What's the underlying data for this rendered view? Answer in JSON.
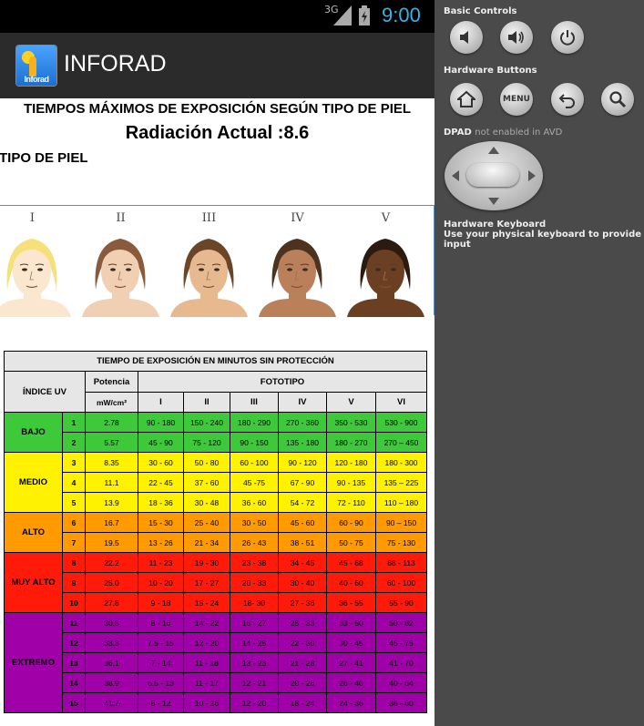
{
  "status_bar": {
    "network": "3G",
    "time": "9:00"
  },
  "app": {
    "title": "INFORAD",
    "logo_text": "Inforad"
  },
  "content": {
    "heading": "TIEMPOS MÁXIMOS DE EXPOSICIÓN SEGÚN TIPO DE PIEL",
    "radiation": "Radiación Actual :8.6",
    "skin_type_label": "TIPO DE PIEL",
    "skin_types": [
      "I",
      "II",
      "III",
      "IV",
      "V"
    ]
  },
  "table": {
    "title": "TIEMPO DE EXPOSICIÓN EN MINUTOS SIN PROTECCIÓN",
    "col_index": "ÍNDICE UV",
    "col_power": "Potencia",
    "col_power_unit": "mW/cm²",
    "col_phototype": "FOTOTIPO",
    "phototypes": [
      "I",
      "II",
      "III",
      "IV",
      "V",
      "VI"
    ],
    "groups": [
      {
        "name": "BAJO",
        "color": "#3ec93a",
        "rows": [
          [
            "1",
            "2.78",
            "90 - 180",
            "150 - 240",
            "180 - 290",
            "270 - 360",
            "350 - 530",
            "530 - 900"
          ],
          [
            "2",
            "5.57",
            "45 - 90",
            "75 - 120",
            "90 - 150",
            "135 - 180",
            "180 - 270",
            "270 – 450"
          ]
        ]
      },
      {
        "name": "MEDIO",
        "color": "#fff200",
        "rows": [
          [
            "3",
            "8.35",
            "30 - 60",
            "50 - 80",
            "60 - 100",
            "90 - 120",
            "120 - 180",
            "180 - 300"
          ],
          [
            "4",
            "11.1",
            "22 - 45",
            "37 - 60",
            "45 -75",
            "67 - 90",
            "90 - 135",
            "135 – 225"
          ],
          [
            "5",
            "13.9",
            "18 - 36",
            "30 - 48",
            "36 - 60",
            "54 - 72",
            "72 - 110",
            "110 – 180"
          ]
        ]
      },
      {
        "name": "ALTO",
        "color": "#ff9a00",
        "rows": [
          [
            "6",
            "16.7",
            "15 - 30",
            "25 - 40",
            "30 - 50",
            "45 - 60",
            "60 - 90",
            "90 – 150"
          ],
          [
            "7",
            "19.5",
            "13 - 26",
            "21 - 34",
            "26 - 43",
            "38 - 51",
            "50 - 75",
            "75 - 130"
          ]
        ]
      },
      {
        "name": "MUY ALTO",
        "color": "#ff1a0a",
        "rows": [
          [
            "8",
            "22.2",
            "11 - 23",
            "19 - 30",
            "23 - 38",
            "34 - 45",
            "45 - 68",
            "68 - 113"
          ],
          [
            "9",
            "25.0",
            "10 - 20",
            "17 - 27",
            "20 - 33",
            "30 - 40",
            "40 - 60",
            "60 - 100"
          ],
          [
            "10",
            "27.8",
            "9 - 18",
            "15 - 24",
            "18- 30",
            "27 - 36",
            "36 - 55",
            "55 - 90"
          ]
        ]
      },
      {
        "name": "EXTREMO",
        "color": "#a000a8",
        "rows": [
          [
            "11",
            "30.5",
            "8 - 16",
            "14 - 22",
            "16 - 27",
            "25 - 33",
            "33 - 50",
            "50 - 82"
          ],
          [
            "12",
            "33.3",
            "7.5 - 15",
            "12 - 20",
            "14 - 25",
            "22 - 30",
            "30 - 45",
            "45 - 75"
          ],
          [
            "13",
            "36.1",
            "7 - 14",
            "11 - 18",
            "13 - 23",
            "21 - 28",
            "27 - 41",
            "41 - 70"
          ],
          [
            "14",
            "38.9",
            "6.5 - 13",
            "11 - 17",
            "12 - 21",
            "20 - 26",
            "26 - 40",
            "40 - 64"
          ],
          [
            "15",
            "41.7",
            "6 - 12",
            "10 - 16",
            "12 - 20",
            "18 - 24",
            "24 - 36",
            "36 - 60"
          ]
        ]
      }
    ]
  },
  "emulator_panel": {
    "basic_controls": "Basic Controls",
    "hardware_buttons": "Hardware Buttons",
    "menu_label": "MENU",
    "dpad_title": "DPAD",
    "dpad_status": "not enabled in AVD",
    "hw_keyboard_title": "Hardware Keyboard",
    "hw_keyboard_desc": "Use your physical keyboard to provide input"
  }
}
